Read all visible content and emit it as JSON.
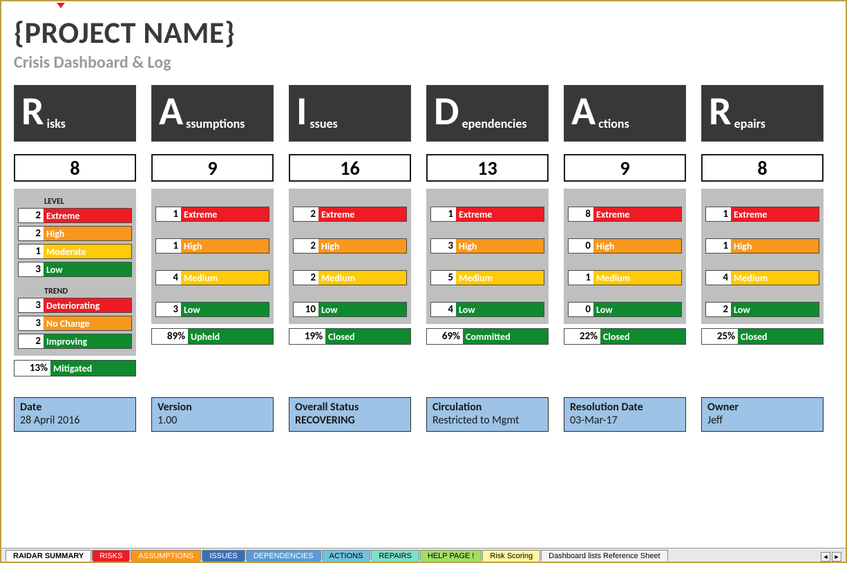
{
  "header": {
    "title": "{PROJECT NAME}",
    "subtitle": "Crisis Dashboard & Log"
  },
  "risks": {
    "letter": "R",
    "word": "isks",
    "count": "8",
    "level_label": "LEVEL",
    "levels": [
      {
        "n": "2",
        "t": "Extreme",
        "c": "c-ext"
      },
      {
        "n": "2",
        "t": "High",
        "c": "c-high"
      },
      {
        "n": "1",
        "t": "Moderate",
        "c": "c-mod"
      },
      {
        "n": "3",
        "t": "Low",
        "c": "c-low"
      }
    ],
    "trend_label": "TREND",
    "trends": [
      {
        "n": "3",
        "t": "Deteriorating",
        "c": "c-ext"
      },
      {
        "n": "3",
        "t": "No Change",
        "c": "c-high"
      },
      {
        "n": "2",
        "t": "Improving",
        "c": "c-low"
      }
    ],
    "status_pct": "13%",
    "status_label": "Mitigated"
  },
  "assumptions": {
    "letter": "A",
    "word": "ssumptions",
    "count": "9",
    "levels": [
      {
        "n": "1",
        "t": "Extreme",
        "c": "c-ext"
      },
      {
        "n": "1",
        "t": "High",
        "c": "c-high"
      },
      {
        "n": "4",
        "t": "Medium",
        "c": "c-mod"
      },
      {
        "n": "3",
        "t": "Low",
        "c": "c-low"
      }
    ],
    "status_pct": "89%",
    "status_label": "Upheld"
  },
  "issues": {
    "letter": "I",
    "word": "ssues",
    "count": "16",
    "levels": [
      {
        "n": "2",
        "t": "Extreme",
        "c": "c-ext"
      },
      {
        "n": "2",
        "t": "High",
        "c": "c-high"
      },
      {
        "n": "2",
        "t": "Medium",
        "c": "c-mod"
      },
      {
        "n": "10",
        "t": "Low",
        "c": "c-low"
      }
    ],
    "status_pct": "19%",
    "status_label": "Closed"
  },
  "dependencies": {
    "letter": "D",
    "word": "ependencies",
    "count": "13",
    "levels": [
      {
        "n": "1",
        "t": "Extreme",
        "c": "c-ext"
      },
      {
        "n": "3",
        "t": "High",
        "c": "c-high"
      },
      {
        "n": "5",
        "t": "Medium",
        "c": "c-mod"
      },
      {
        "n": "4",
        "t": "Low",
        "c": "c-low"
      }
    ],
    "status_pct": "69%",
    "status_label": "Committed"
  },
  "actions": {
    "letter": "A",
    "word": "ctions",
    "count": "9",
    "levels": [
      {
        "n": "8",
        "t": "Extreme",
        "c": "c-ext"
      },
      {
        "n": "0",
        "t": "High",
        "c": "c-high"
      },
      {
        "n": "1",
        "t": "Medium",
        "c": "c-mod"
      },
      {
        "n": "0",
        "t": "Low",
        "c": "c-low"
      }
    ],
    "status_pct": "22%",
    "status_label": "Closed"
  },
  "repairs": {
    "letter": "R",
    "word": "epairs",
    "count": "8",
    "levels": [
      {
        "n": "1",
        "t": "Extreme",
        "c": "c-ext"
      },
      {
        "n": "1",
        "t": "High",
        "c": "c-high"
      },
      {
        "n": "4",
        "t": "Medium",
        "c": "c-mod"
      },
      {
        "n": "2",
        "t": "Low",
        "c": "c-low"
      }
    ],
    "status_pct": "25%",
    "status_label": "Closed"
  },
  "info": {
    "date_k": "Date",
    "date_v": "28 April 2016",
    "ver_k": "Version",
    "ver_v": "1.00",
    "stat_k": "Overall Status",
    "stat_v": "RECOVERING",
    "circ_k": "Circulation",
    "circ_v": "Restricted to Mgmt",
    "res_k": "Resolution Date",
    "res_v": "03-Mar-17",
    "own_k": "Owner",
    "own_v": "Jeff"
  },
  "tabs": {
    "t0": "RAIDAR SUMMARY",
    "t1": "RISKS",
    "t2": "ASSUMPTIONS",
    "t3": "ISSUES",
    "t4": "DEPENDENCIES",
    "t5": "ACTIONS",
    "t6": "REPAIRS",
    "t7": "HELP PAGE !",
    "t8": "Risk Scoring",
    "t9": "Dashboard lists Reference Sheet"
  }
}
